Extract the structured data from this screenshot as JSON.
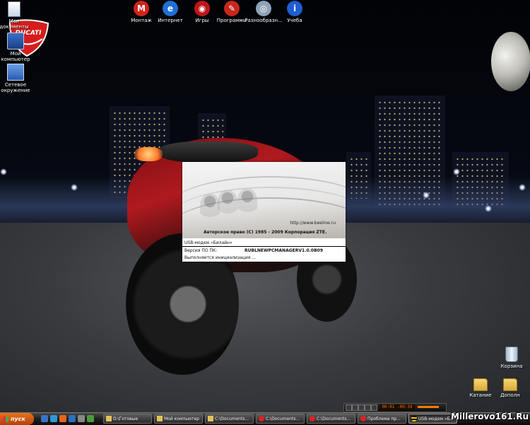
{
  "launcher": [
    {
      "label": "Монтаж",
      "icon": "montage-icon",
      "color": "#d2241c",
      "glyph": "M"
    },
    {
      "label": "Интернет",
      "icon": "internet-icon",
      "color": "#1f6fd6",
      "glyph": "e"
    },
    {
      "label": "Игры",
      "icon": "games-icon",
      "color": "#c0161a",
      "glyph": "◉"
    },
    {
      "label": "Программы",
      "icon": "programs-icon",
      "color": "#c8261e",
      "glyph": "✎"
    },
    {
      "label": "Разнообразн...",
      "icon": "cd-icon",
      "color": "#8fa3b8",
      "glyph": "◎"
    },
    {
      "label": "Учеба",
      "icon": "info-icon",
      "color": "#1d5fd0",
      "glyph": "i"
    }
  ],
  "desktop_icons": {
    "my_documents": "Мои\nдокументы",
    "my_computer": "Мой\nкомпьютер",
    "network": "Сетевое\nокружение",
    "recycle_bin": "Корзина",
    "folder_1": "Катание",
    "folder_2": "Дополн"
  },
  "ducati_logo": "DUCATI",
  "splash": {
    "url": "http://www.beeline.ru",
    "copyright": "Авторское право (С) 1985 - 2009 Корпорация ZTE.",
    "line1": "USB-модем «Билайн»",
    "line2_label": "Версия ПО ПК:",
    "line2_value": "RUBLNEWPCMANAGERV1.0.0B09",
    "line3": "Выполняется инициализация ..."
  },
  "media": {
    "display": "00:01 -00:39"
  },
  "taskbar": {
    "start_label": "пуск",
    "tasks": [
      {
        "label": "D:\\Готовые",
        "icon": "folder-icon",
        "active": false
      },
      {
        "label": "Мой компьютер",
        "icon": "my-computer-icon",
        "active": false
      },
      {
        "label": "C:\\Documents...",
        "icon": "folder-icon",
        "active": false
      },
      {
        "label": "C:\\Documents...",
        "icon": "opera-icon",
        "active": false
      },
      {
        "label": "C:\\Documents...",
        "icon": "opera-icon",
        "active": false
      },
      {
        "label": "Проблема пр...",
        "icon": "opera-icon",
        "active": false
      },
      {
        "label": "USB-модем «Б...",
        "icon": "beeline-icon",
        "active": true
      }
    ]
  },
  "watermark": "Millerovo161.Ru"
}
